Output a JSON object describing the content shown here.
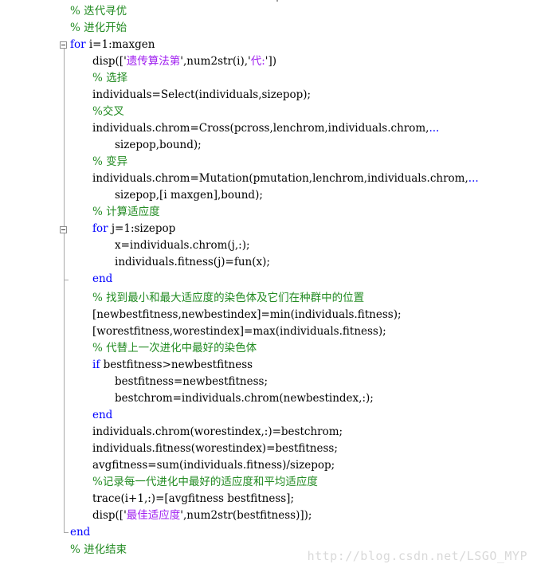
{
  "code_lines": [
    {
      "text": "% 迭代寻优"
    },
    {
      "text": "% 进化开始"
    },
    {
      "kw": "for",
      "text": " i=1:maxgen"
    },
    {
      "pre": "disp(['",
      "str": "遗传算法第",
      "mid": "',num2str(i),'",
      "str2": "代:",
      "post": "'])"
    },
    {
      "text": "% 选择"
    },
    {
      "text": "individuals=Select(individuals,sizepop);"
    },
    {
      "text": "%交叉"
    },
    {
      "text": "individuals.chrom=Cross(pcross,lenchrom,individuals.chrom,",
      "cont": "..."
    },
    {
      "text": "sizepop,bound);"
    },
    {
      "text": "% 变异"
    },
    {
      "text": "individuals.chrom=Mutation(pmutation,lenchrom,individuals.chrom,",
      "cont": "..."
    },
    {
      "text": "sizepop,[i maxgen],bound);"
    },
    {
      "text": "% 计算适应度"
    },
    {
      "kw": "for",
      "text": " j=1:sizepop"
    },
    {
      "text": "x=individuals.chrom(j,:);"
    },
    {
      "text": "individuals.fitness(j)=fun(x);"
    },
    {
      "kw": "end"
    },
    {
      "text": "% 找到最小和最大适应度的染色体及它们在种群中的位置"
    },
    {
      "text": "[newbestfitness,newbestindex]=min(individuals.fitness);"
    },
    {
      "text": "[worestfitness,worestindex]=max(individuals.fitness);"
    },
    {
      "text": "% 代替上一次进化中最好的染色体"
    },
    {
      "kw": "if",
      "text": " bestfitness>newbestfitness"
    },
    {
      "text": "bestfitness=newbestfitness;"
    },
    {
      "text": "bestchrom=individuals.chrom(newbestindex,:);"
    },
    {
      "kw": "end"
    },
    {
      "text": "individuals.chrom(worestindex,:)=bestchrom;"
    },
    {
      "text": "individuals.fitness(worestindex)=bestfitness;"
    },
    {
      "text": "avgfitness=sum(individuals.fitness)/sizepop;"
    },
    {
      "text": "%记录每一代进化中最好的适应度和平均适应度"
    },
    {
      "text": "trace(i+1,:)=[avgfitness bestfitness];"
    },
    {
      "pre": "disp(['",
      "str": "最佳适应度",
      "post": "',num2str(bestfitness)]);"
    },
    {
      "kw": "end"
    },
    {
      "text": "% 进化结束"
    }
  ],
  "watermark": "http://blog.csdn.net/LSGO_MYP",
  "colors": {
    "keyword": "#0000ff",
    "comment": "#228b22",
    "string": "#a020f0",
    "text": "#000000"
  }
}
